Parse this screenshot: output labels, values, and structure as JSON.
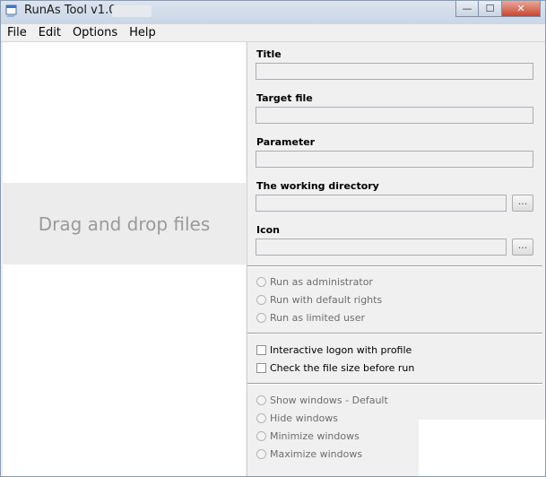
{
  "window": {
    "title": "RunAs Tool v1.0 ·",
    "minimize_glyph": "—",
    "maximize_glyph": "☐",
    "close_glyph": "✕"
  },
  "menu": {
    "items": [
      "File",
      "Edit",
      "Options",
      "Help"
    ]
  },
  "drop_zone": {
    "text": "Drag and drop files"
  },
  "fields": {
    "title": {
      "label": "Title",
      "value": ""
    },
    "target_file": {
      "label": "Target file",
      "value": ""
    },
    "parameter": {
      "label": "Parameter",
      "value": ""
    },
    "working_directory": {
      "label": "The working directory",
      "value": "",
      "browse_label": "..."
    },
    "icon": {
      "label": "Icon",
      "value": "",
      "browse_label": "..."
    }
  },
  "run_mode": {
    "options": [
      "Run as administrator",
      "Run with default rights",
      "Run as limited user"
    ]
  },
  "checks": {
    "options": [
      "Interactive logon with profile",
      "Check the file size before run"
    ]
  },
  "window_mode": {
    "options": [
      "Show windows - Default",
      "Hide windows",
      "Minimize windows",
      "Maximize windows"
    ]
  }
}
